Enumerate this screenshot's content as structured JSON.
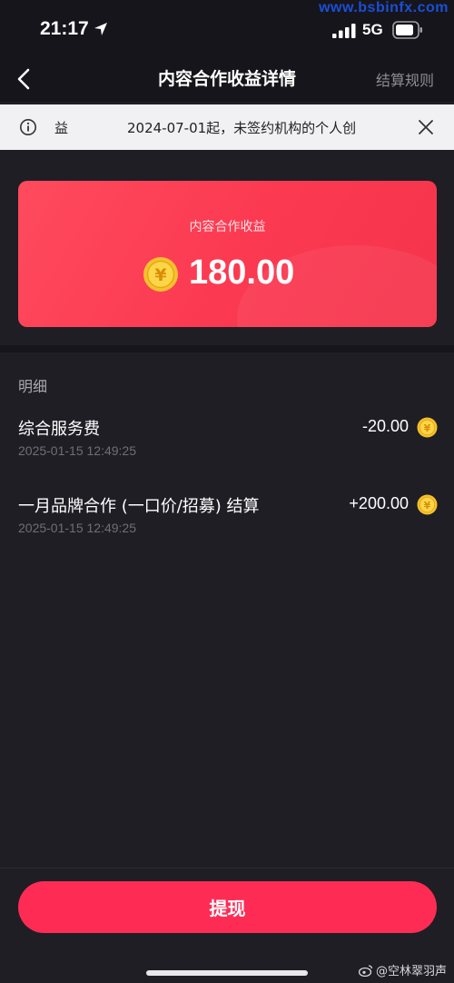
{
  "watermark": "www.bsbinfx.com",
  "status_bar": {
    "time": "21:17",
    "network": "5G",
    "icons": [
      "location-arrow-icon",
      "signal-icon",
      "battery-icon"
    ]
  },
  "header": {
    "title": "内容合作收益详情",
    "right_link": "结算规则",
    "back_icon": "chevron-left-icon"
  },
  "notice": {
    "label": "益",
    "text": "2024-07-01起，未签约机构的个人创",
    "icons": [
      "info-icon",
      "close-icon"
    ]
  },
  "earnings_card": {
    "label": "内容合作收益",
    "amount": "180.00",
    "coin_icon": "yen-coin-icon"
  },
  "details": {
    "title": "明细",
    "rows": [
      {
        "title": "综合服务费",
        "date": "2025-01-15 12:49:25",
        "amount": "-20.00"
      },
      {
        "title": "一月品牌合作 (一口价/招募) 结算",
        "date": "2025-01-15 12:49:25",
        "amount": "+200.00"
      }
    ]
  },
  "footer": {
    "withdraw_label": "提现",
    "credit": "@空林翠羽声"
  },
  "colors": {
    "background": "#1f1e25",
    "accent": "#fe2c55",
    "card": "#fb3951",
    "coin": "#f5c530"
  }
}
